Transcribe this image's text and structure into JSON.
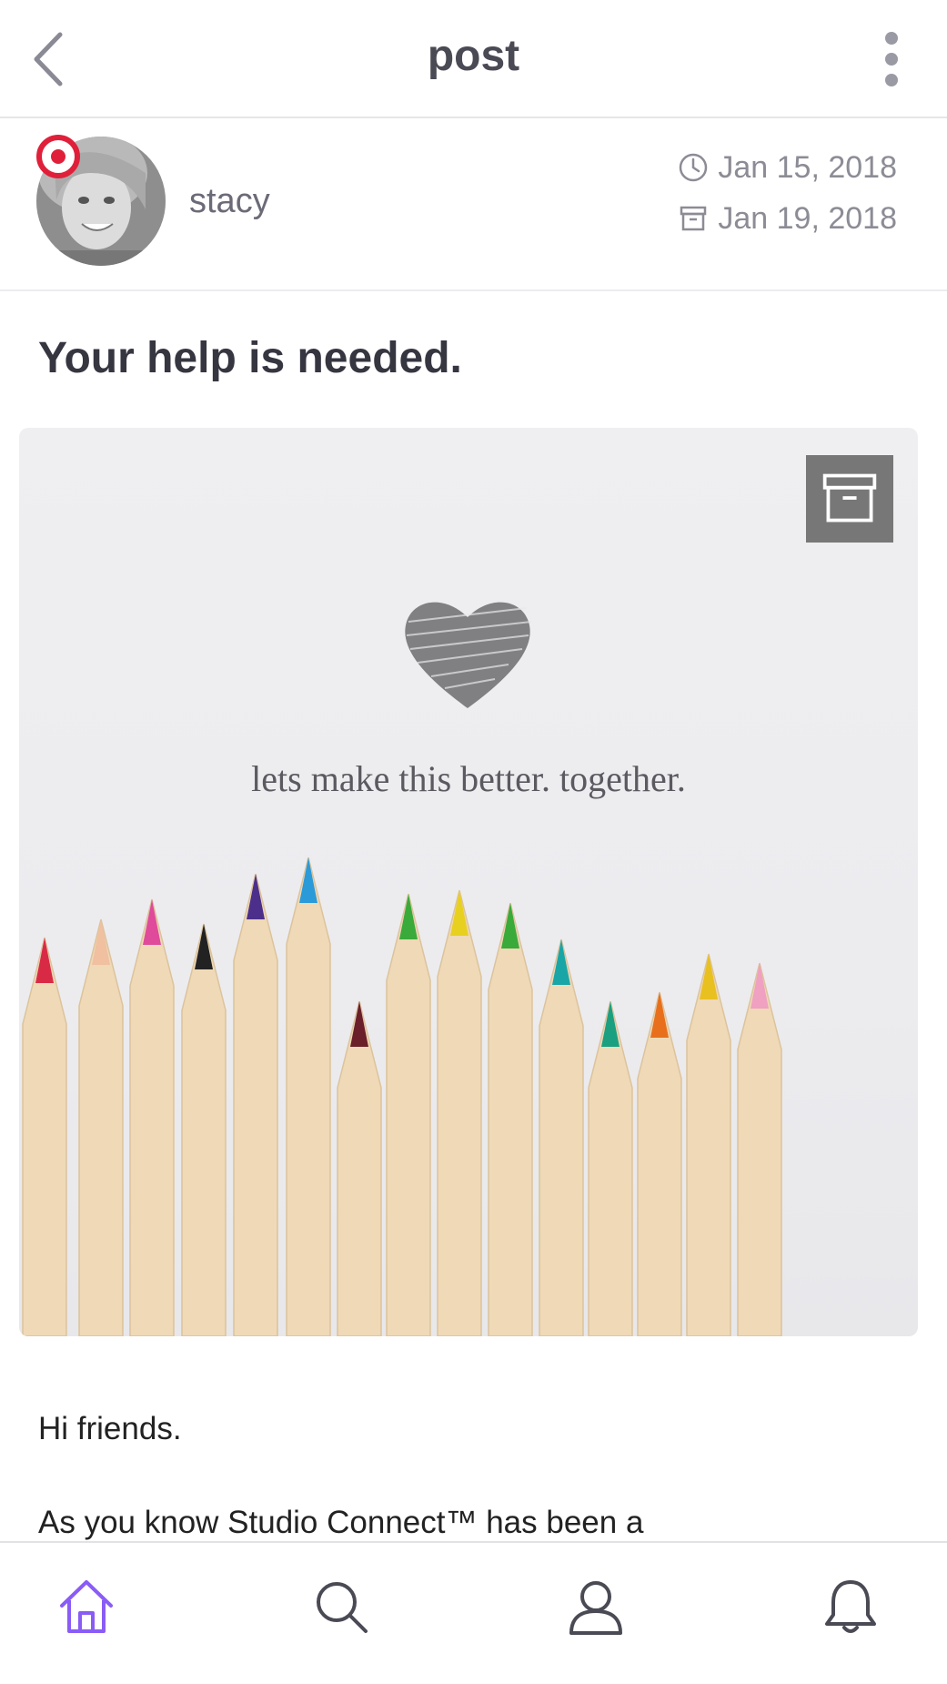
{
  "header": {
    "title": "post",
    "back_icon": "chevron-left-icon",
    "more_icon": "vertical-dots-icon"
  },
  "author": {
    "name": "stacy",
    "badge_icon": "target-badge-icon",
    "created_date": "Jan 15, 2018",
    "archive_date": "Jan 19, 2018"
  },
  "post": {
    "title": "Your help is needed.",
    "image_caption": "lets make this better. together.",
    "body_lines": [
      "Hi friends.",
      "As you know Studio Connect™ has been a"
    ]
  },
  "bottom_nav": {
    "items": [
      {
        "icon": "home-icon",
        "active": true
      },
      {
        "icon": "search-icon",
        "active": false
      },
      {
        "icon": "profile-icon",
        "active": false
      },
      {
        "icon": "bell-icon",
        "active": false
      }
    ]
  },
  "colors": {
    "accent": "#8a5cf6",
    "badge_red": "#e0203a",
    "icon_gray": "#7a7a85"
  }
}
